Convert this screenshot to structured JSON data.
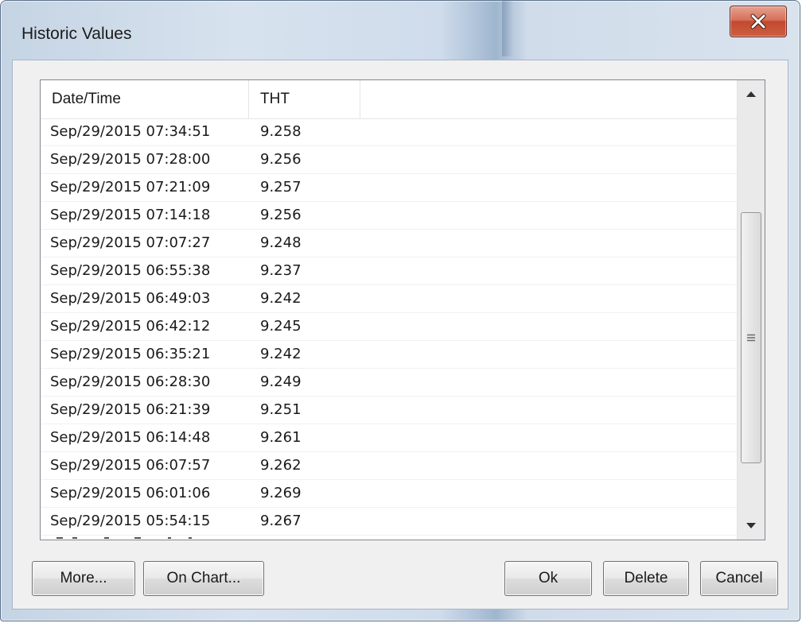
{
  "window": {
    "title": "Historic Values",
    "close_icon": "close-icon"
  },
  "table": {
    "columns": [
      "Date/Time",
      "THT"
    ],
    "rows": [
      {
        "datetime": "Sep/29/2015 07:34:51",
        "value": "9.258"
      },
      {
        "datetime": "Sep/29/2015 07:28:00",
        "value": "9.256"
      },
      {
        "datetime": "Sep/29/2015 07:21:09",
        "value": "9.257"
      },
      {
        "datetime": "Sep/29/2015 07:14:18",
        "value": "9.256"
      },
      {
        "datetime": "Sep/29/2015 07:07:27",
        "value": "9.248"
      },
      {
        "datetime": "Sep/29/2015 06:55:38",
        "value": "9.237"
      },
      {
        "datetime": "Sep/29/2015 06:49:03",
        "value": "9.242"
      },
      {
        "datetime": "Sep/29/2015 06:42:12",
        "value": "9.245"
      },
      {
        "datetime": "Sep/29/2015 06:35:21",
        "value": "9.242"
      },
      {
        "datetime": "Sep/29/2015 06:28:30",
        "value": "9.249"
      },
      {
        "datetime": "Sep/29/2015 06:21:39",
        "value": "9.251"
      },
      {
        "datetime": "Sep/29/2015 06:14:48",
        "value": "9.261"
      },
      {
        "datetime": "Sep/29/2015 06:07:57",
        "value": "9.262"
      },
      {
        "datetime": "Sep/29/2015 06:01:06",
        "value": "9.269"
      },
      {
        "datetime": "Sep/29/2015 05:54:15",
        "value": "9.267"
      }
    ]
  },
  "buttons": {
    "more": "More...",
    "on_chart": "On Chart...",
    "ok": "Ok",
    "delete": "Delete",
    "cancel": "Cancel"
  },
  "colors": {
    "close_button": "#c14a2f",
    "frame": "#c5d4e4",
    "client": "#f0f0f0"
  }
}
